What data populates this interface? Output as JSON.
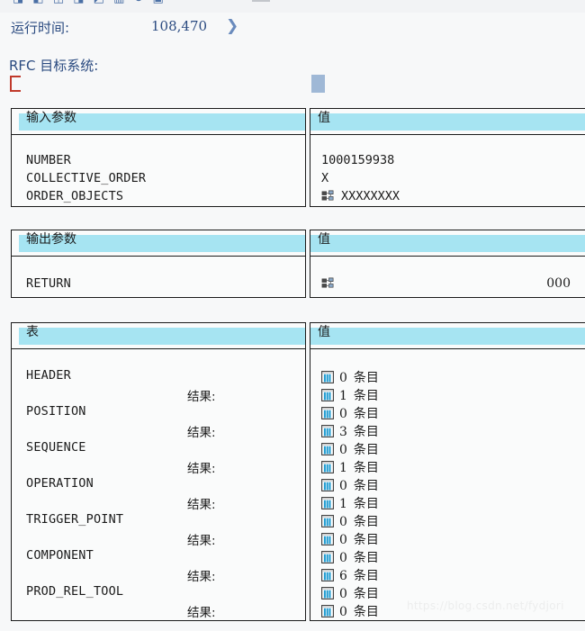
{
  "toolbar": {
    "glyph_row": "◨ ◧ ◫  ◨ ◩ ▥ ↻ ▣",
    "chip": ""
  },
  "runtime": {
    "label": "运行时间:",
    "value": "108,470",
    "chevron": "❯"
  },
  "rfc": {
    "label": "RFC 目标系统:",
    "input_value": ""
  },
  "input_section": {
    "header_left": "输入参数",
    "header_right": "值",
    "rows": [
      {
        "name": "NUMBER",
        "value": "1000159938",
        "icon": ""
      },
      {
        "name": "COLLECTIVE_ORDER",
        "value": "X",
        "icon": ""
      },
      {
        "name": "ORDER_OBJECTS",
        "value": "XXXXXXXX",
        "icon": "structure-icon"
      }
    ]
  },
  "output_section": {
    "header_left": "输出参数",
    "header_right": "值",
    "rows": [
      {
        "name": "RETURN",
        "value": "000",
        "icon": "structure-icon"
      }
    ]
  },
  "tables_section": {
    "header_left": "表",
    "header_right": "值",
    "result_label": "结果:",
    "unit": "条目",
    "icon": "table-icon",
    "rows": [
      {
        "name": "HEADER",
        "count": "0",
        "result_count": "1"
      },
      {
        "name": "POSITION",
        "count": "0",
        "result_count": "3"
      },
      {
        "name": "SEQUENCE",
        "count": "0",
        "result_count": "1"
      },
      {
        "name": "OPERATION",
        "count": "0",
        "result_count": "1"
      },
      {
        "name": "TRIGGER_POINT",
        "count": "0",
        "result_count": "0"
      },
      {
        "name": "COMPONENT",
        "count": "0",
        "result_count": "6"
      },
      {
        "name": "PROD_REL_TOOL",
        "count": "0",
        "result_count": "0"
      }
    ]
  },
  "watermark": "https://blog.csdn.net/fydjori",
  "colors": {
    "header_band": "#a6e4f2",
    "accent_text": "#2a4a80",
    "marker_red": "#c0392b",
    "blue_box": "#9fb8d6",
    "border": "#1b1b1b",
    "page_bg": "#f7f8f9"
  }
}
